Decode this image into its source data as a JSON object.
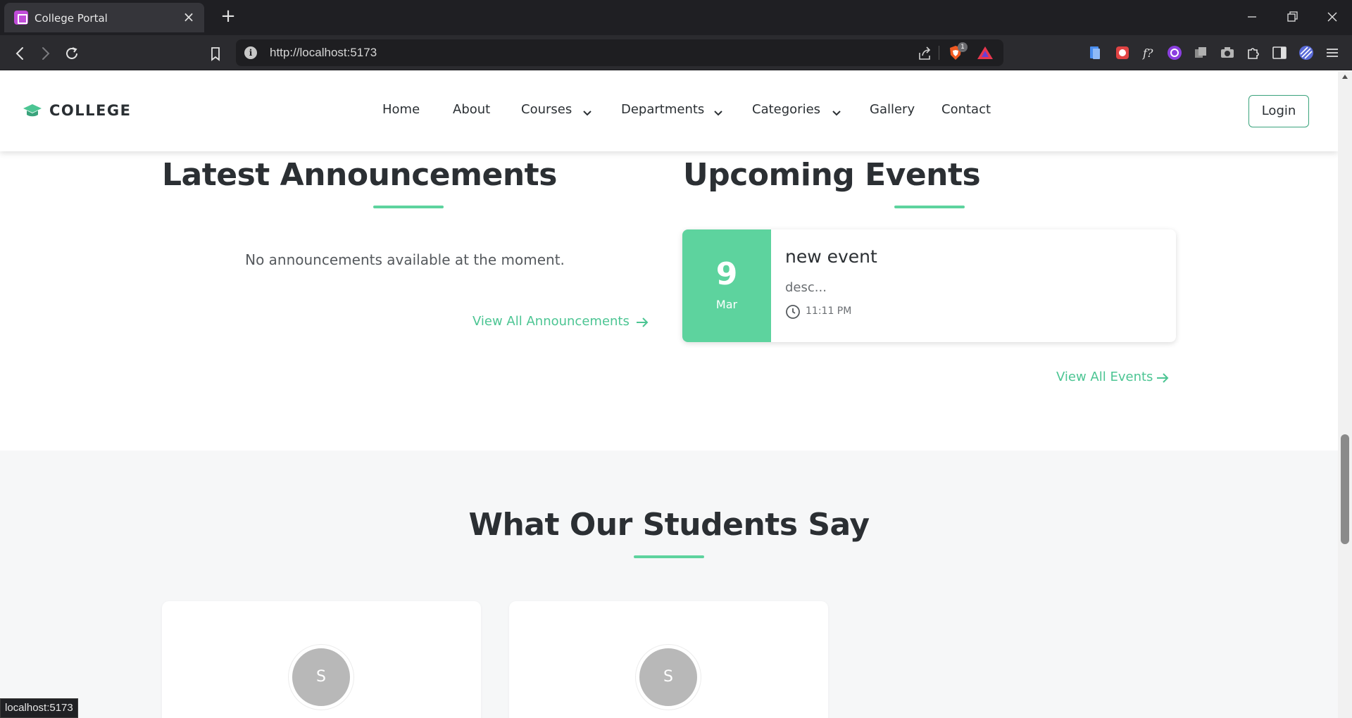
{
  "browser": {
    "tab_title": "College Portal",
    "url": "http://localhost:5173",
    "shields_badge": "1",
    "status_text": "localhost:5173",
    "icons": [
      "back-icon",
      "forward-icon",
      "reload-icon",
      "bookmark-icon",
      "site-info-icon",
      "share-icon",
      "brave-shields-icon",
      "brave-rewards-icon",
      "extension-icons",
      "menu-icon"
    ]
  },
  "site": {
    "logo": "COLLEGE",
    "nav": {
      "home": "Home",
      "about": "About",
      "courses": "Courses",
      "departments": "Departments",
      "categories": "Categories",
      "gallery": "Gallery",
      "contact": "Contact"
    },
    "login": "Login",
    "accent_color": "#5dd39e"
  },
  "announcements": {
    "title": "Latest Announcements",
    "empty": "No announcements available at the moment.",
    "view_all": "View All Announcements"
  },
  "events": {
    "title": "Upcoming Events",
    "items": [
      {
        "day": "9",
        "month": "Mar",
        "title": "new event",
        "desc": "desc...",
        "time": "11:11 PM"
      }
    ],
    "view_all": "View All Events"
  },
  "testimonials": {
    "title": "What Our Students Say",
    "cards": [
      {
        "initial": "S"
      },
      {
        "initial": "S"
      }
    ]
  }
}
